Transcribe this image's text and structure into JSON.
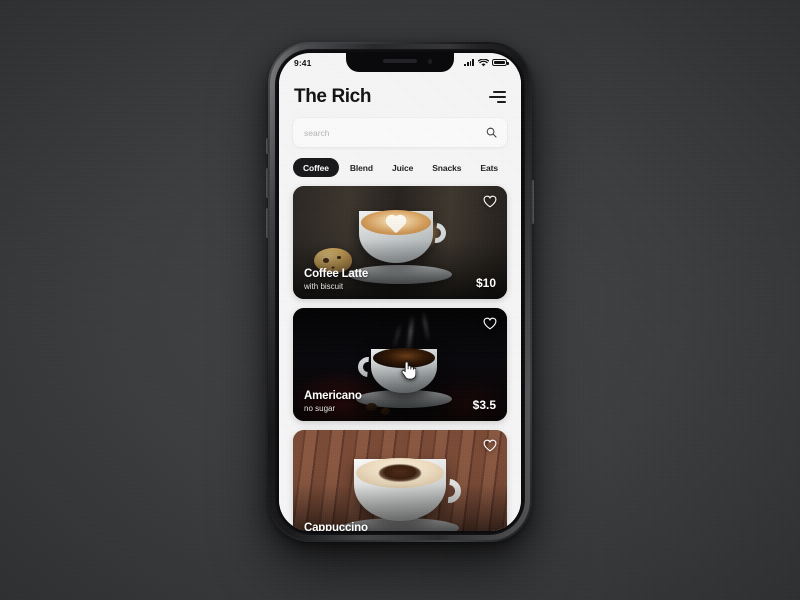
{
  "status_bar": {
    "time": "9:41",
    "icons": [
      "cellular-signal-icon",
      "wifi-icon",
      "battery-icon"
    ]
  },
  "header": {
    "title": "The Rich",
    "menu_icon": "hamburger-menu-icon"
  },
  "search": {
    "value": "",
    "placeholder": "search",
    "icon": "search-icon"
  },
  "categories": [
    {
      "label": "Coffee",
      "active": true
    },
    {
      "label": "Blend",
      "active": false
    },
    {
      "label": "Juice",
      "active": false
    },
    {
      "label": "Snacks",
      "active": false
    },
    {
      "label": "Eats",
      "active": false
    }
  ],
  "products": [
    {
      "name": "Coffee Latte",
      "subtitle": "with biscuit",
      "price": "$10",
      "favorite_icon": "heart-outline-icon"
    },
    {
      "name": "Americano",
      "subtitle": "no sugar",
      "price": "$3.5",
      "favorite_icon": "heart-outline-icon"
    },
    {
      "name": "Cappuccino",
      "subtitle": "",
      "price": "",
      "favorite_icon": "heart-outline-icon"
    }
  ],
  "colors": {
    "backdrop": "#3a3b3d",
    "app_background": "#f7f7f7",
    "accent_dark": "#17171a",
    "text_primary": "#111111",
    "placeholder": "#b5b5b5",
    "card_text": "#ffffff"
  },
  "cursor": {
    "type": "pointer-hand-cursor"
  }
}
